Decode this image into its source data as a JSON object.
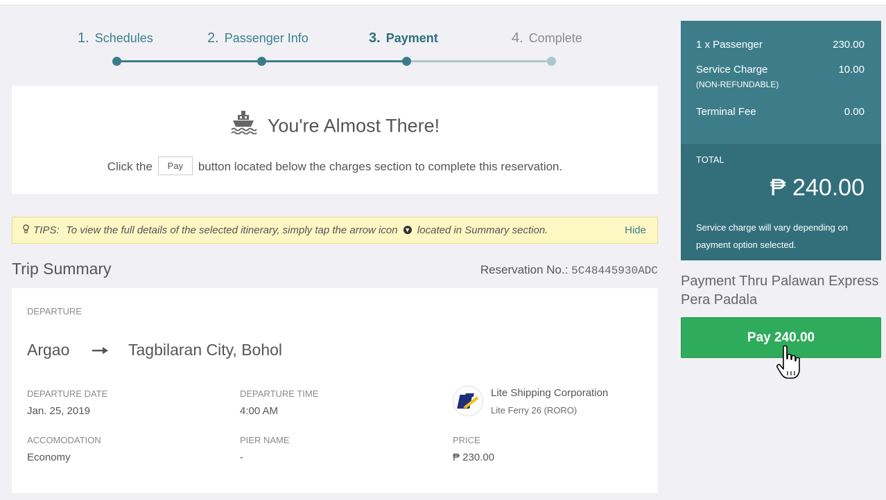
{
  "steps": [
    {
      "num": "1.",
      "label": "Schedules"
    },
    {
      "num": "2.",
      "label": "Passenger Info"
    },
    {
      "num": "3.",
      "label": "Payment"
    },
    {
      "num": "4.",
      "label": "Complete"
    }
  ],
  "almost": {
    "title": "You're Almost There!",
    "text_before": "Click the",
    "chip": "Pay",
    "text_after": "button located below the charges section to complete this reservation."
  },
  "tips": {
    "label": "TIPS:",
    "text_before": "To view the full details of the selected itinerary, simply tap the arrow icon",
    "text_after": "located in Summary section.",
    "hide": "Hide"
  },
  "summary": {
    "title": "Trip Summary",
    "res_label": "Reservation No.:",
    "res_code": "5C48445930ADC",
    "section": "DEPARTURE",
    "origin": "Argao",
    "destination": "Tagbilaran City, Bohol",
    "dep_date_label": "DEPARTURE DATE",
    "dep_date": "Jan. 25, 2019",
    "dep_time_label": "DEPARTURE TIME",
    "dep_time": "4:00 AM",
    "company": "Lite Shipping Corporation",
    "vessel": "Lite Ferry 26 (RORO)",
    "accom_label": "ACCOMODATION",
    "accom": "Economy",
    "pier_label": "PIER NAME",
    "pier": "-",
    "price_label": "PRICE",
    "price": "₱ 230.00"
  },
  "charges": {
    "passenger_label": "1 x Passenger",
    "passenger_amt": "230.00",
    "service_label": "Service Charge",
    "service_sub": "(NON-REFUNDABLE)",
    "service_amt": "10.00",
    "terminal_label": "Terminal Fee",
    "terminal_amt": "0.00",
    "total_label": "TOTAL",
    "total_amt": "₱ 240.00",
    "note": "Service charge will vary depending on payment option selected."
  },
  "payment": {
    "method": "Payment Thru Palawan Express Pera Padala",
    "button": "Pay 240.00"
  },
  "colors": {
    "accent": "#3d7d8a",
    "pay_green": "#2eac5c",
    "tips_bg": "#fdf7c3"
  }
}
